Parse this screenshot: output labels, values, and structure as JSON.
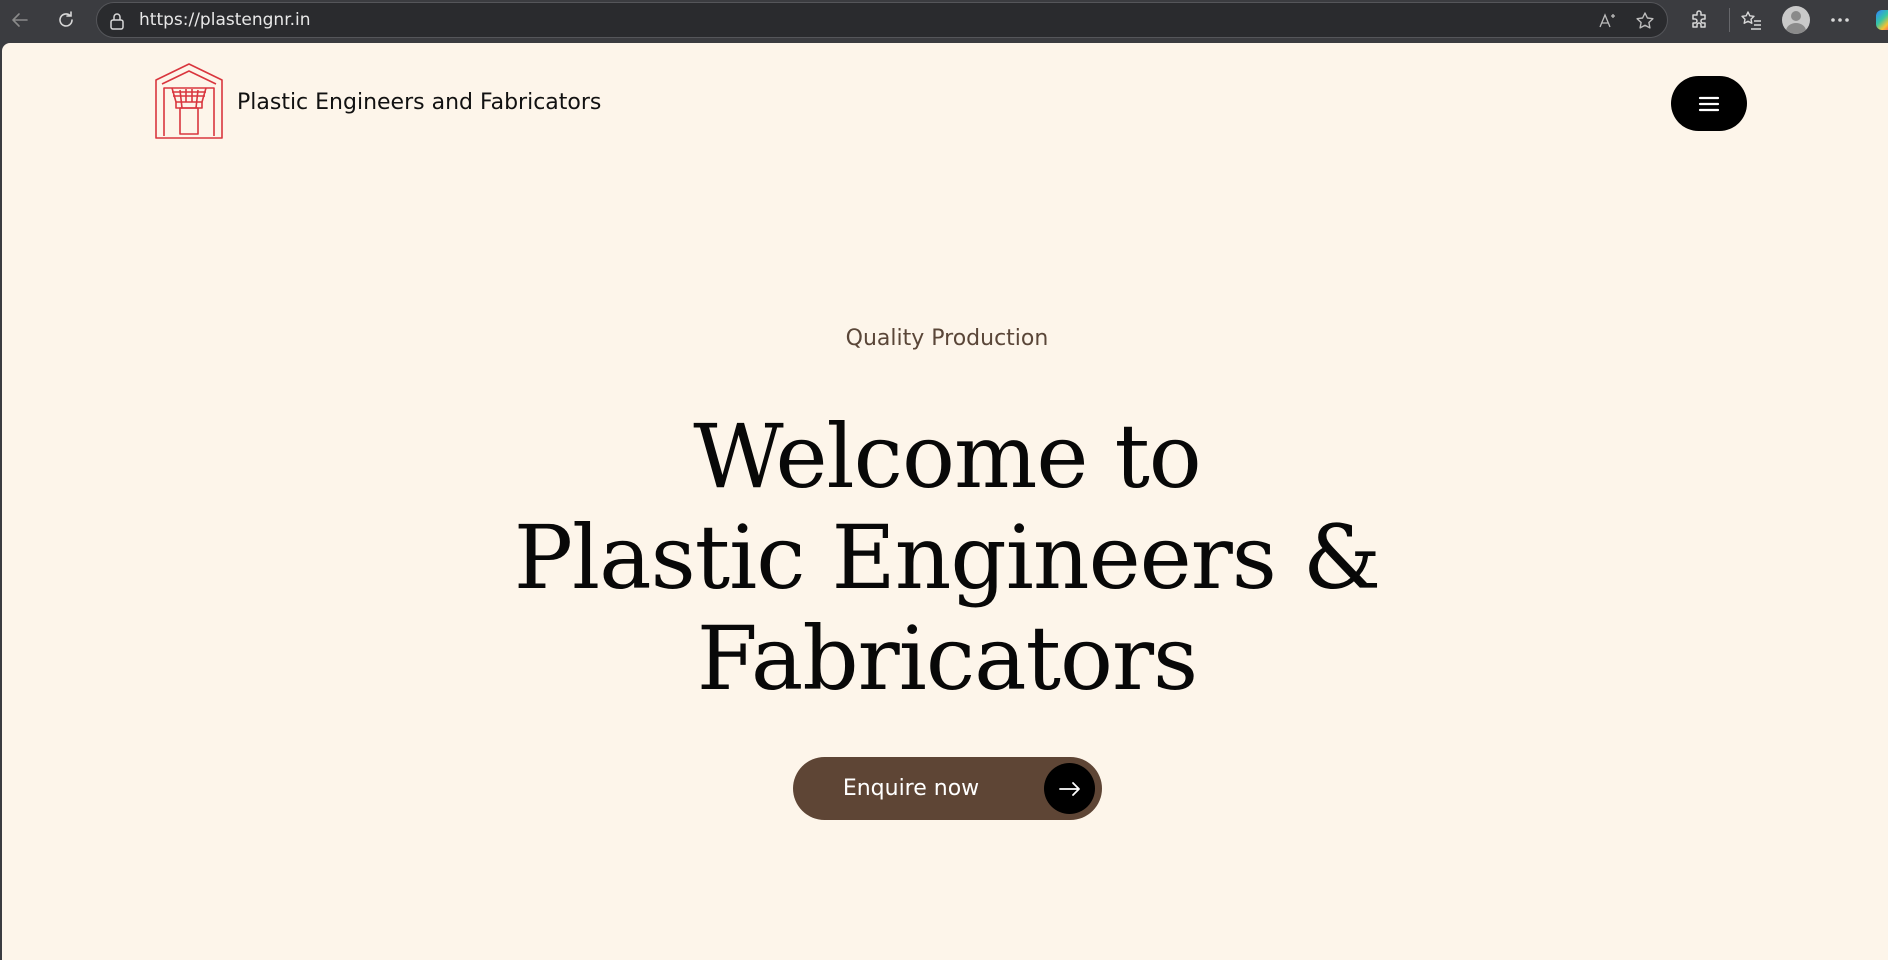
{
  "browser": {
    "url": "https://plastengnr.in",
    "icons": [
      "back-icon",
      "refresh-icon",
      "lock-icon",
      "read-aloud-icon",
      "favorite-star-icon",
      "extensions-icon",
      "favorites-list-icon",
      "profile-icon",
      "more-icon",
      "copilot-icon"
    ]
  },
  "header": {
    "site_name": "Plastic Engineers and Fabricators",
    "logo_color": "#d9363e",
    "menu_icon": "hamburger-icon"
  },
  "hero": {
    "eyebrow": "Quality Production",
    "title_lines": [
      "Welcome to",
      "Plastic Engineers &",
      "Fabricators"
    ],
    "cta_label": "Enquire now",
    "cta_icon": "arrow-right-icon"
  },
  "colors": {
    "page_background": "#fdf5ea",
    "cta_background": "#5e4535",
    "text": "#080808",
    "eyebrow_text": "#5a4638"
  }
}
